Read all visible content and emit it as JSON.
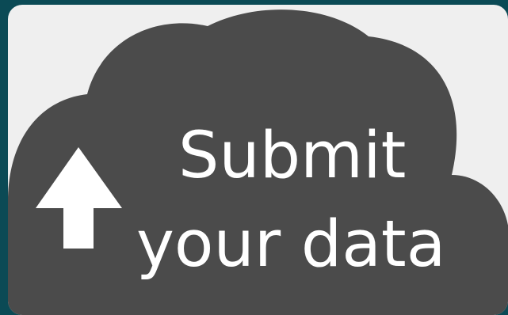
{
  "button": {
    "line1": "Submit",
    "line2": "your data",
    "icon": "upload-arrow-icon",
    "colors": {
      "frame": "#0b4a55",
      "card": "#efefef",
      "cloud": "#4b4b4b",
      "text": "#ffffff"
    }
  }
}
